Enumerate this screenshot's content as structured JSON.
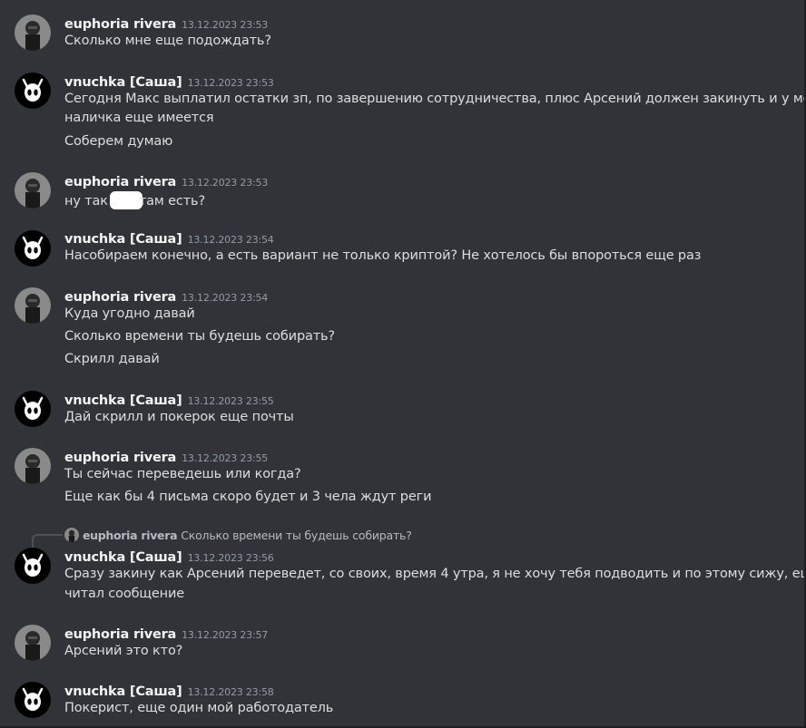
{
  "users": {
    "euphoria": {
      "name": "euphoria rivera",
      "avatar_icon": "user-photo-avatar"
    },
    "vnuchka": {
      "name": "vnuchka [Саша]",
      "avatar_icon": "hollow-knight-mask-avatar"
    }
  },
  "messages": [
    {
      "author": "euphoria rivera",
      "time": "13.12.2023 23:53",
      "lines": [
        "Сколько мне  еще подождать?"
      ]
    },
    {
      "author": "vnuchka [Саша]",
      "time": "13.12.2023 23:53",
      "lines": [
        "Сегодня Макс выплатил остатки зп, по завершению сотрудничества, плюс Арсений должен закинуть и у меня",
        "наличка еще имеется",
        "Соберем думаю"
      ]
    },
    {
      "author": "euphoria rivera",
      "time": "13.12.2023 23:53",
      "lines": [
        "ну так",
        "там есть?"
      ]
    },
    {
      "author": "vnuchka [Саша]",
      "time": "13.12.2023 23:54",
      "lines": [
        "Насобираем конечно, а есть вариант не только криптой? Не хотелось бы впороться еще раз"
      ]
    },
    {
      "author": "euphoria rivera",
      "time": "13.12.2023 23:54",
      "lines": [
        "Куда угодно давай",
        "Сколько времени ты будешь собирать?",
        "Скрилл давай"
      ]
    },
    {
      "author": "vnuchka [Саша]",
      "time": "13.12.2023 23:55",
      "lines": [
        "Дай скрилл и покерок еще почты"
      ]
    },
    {
      "author": "euphoria rivera",
      "time": "13.12.2023 23:55",
      "lines": [
        "Ты сейчас переведешь или когда?",
        "Еще как бы 4 письма скоро будет и 3 чела ждут реги"
      ]
    },
    {
      "author": "vnuchka [Саша]",
      "time": "13.12.2023 23:56",
      "reply": {
        "author": "euphoria rivera",
        "text": "Сколько времени ты будешь собирать?"
      },
      "lines": [
        "Сразу закину как Арсений переведет, со своих, время 4 утра, я не хочу тебя подводить и по этому сижу, еще не",
        "читал сообщение"
      ]
    },
    {
      "author": "euphoria rivera",
      "time": "13.12.2023 23:57",
      "lines": [
        "Арсений это кто?"
      ]
    },
    {
      "author": "vnuchka [Саша]",
      "time": "13.12.2023 23:58",
      "lines": [
        "Покерист, еще один мой работодатель"
      ]
    }
  ]
}
